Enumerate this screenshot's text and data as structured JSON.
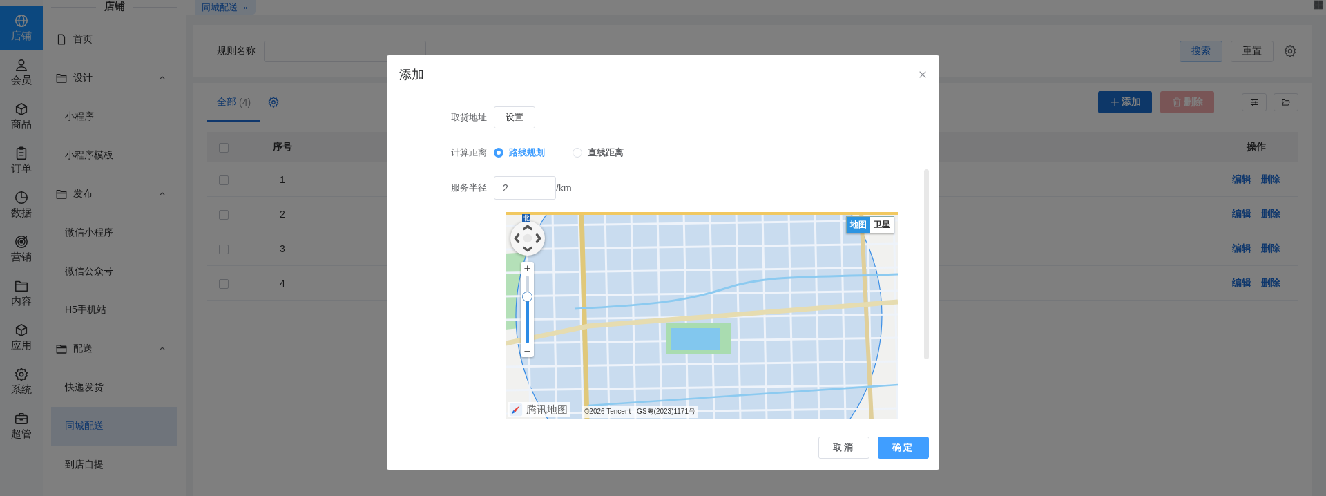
{
  "rail": {
    "items": [
      {
        "label": "店铺",
        "selected": true
      },
      {
        "label": "会员",
        "selected": false
      },
      {
        "label": "商品",
        "selected": false
      },
      {
        "label": "订单",
        "selected": false
      },
      {
        "label": "数据",
        "selected": false
      },
      {
        "label": "营销",
        "selected": false
      },
      {
        "label": "内容",
        "selected": false
      },
      {
        "label": "应用",
        "selected": false
      },
      {
        "label": "系统",
        "selected": false
      },
      {
        "label": "超管",
        "selected": false
      }
    ]
  },
  "sidebar": {
    "title": "店铺",
    "items": [
      {
        "kind": "link",
        "label": "首页",
        "selected": false
      },
      {
        "kind": "group",
        "label": "设计",
        "expanded": true,
        "children": [
          {
            "label": "小程序",
            "selected": false
          },
          {
            "label": "小程序模板",
            "selected": false
          }
        ]
      },
      {
        "kind": "group",
        "label": "发布",
        "expanded": true,
        "children": [
          {
            "label": "微信小程序",
            "selected": false
          },
          {
            "label": "微信公众号",
            "selected": false
          },
          {
            "label": "H5手机站",
            "selected": false
          }
        ]
      },
      {
        "kind": "group",
        "label": "配送",
        "expanded": true,
        "children": [
          {
            "label": "快递发货",
            "selected": false
          },
          {
            "label": "同城配送",
            "selected": true
          },
          {
            "label": "到店自提",
            "selected": false
          }
        ]
      }
    ]
  },
  "page_tabs": [
    {
      "label": "同城配送",
      "selected": true
    }
  ],
  "search": {
    "label": "规则名称",
    "buttons": [
      {
        "label": "搜索",
        "kind": "primary"
      },
      {
        "label": "重置",
        "kind": "default"
      }
    ]
  },
  "table_card": {
    "tabs": [
      {
        "label": "全部",
        "count": "(4)",
        "selected": true
      }
    ],
    "actions": [
      {
        "label": "添加",
        "kind": "add",
        "disabled": false
      },
      {
        "label": "删除",
        "kind": "delete",
        "disabled": true
      }
    ],
    "table": {
      "select_all": {
        "checked": false
      },
      "columns": [
        "序号",
        "操作"
      ],
      "rows": [
        {
          "checked": false,
          "index": "1",
          "actions": [
            "编辑",
            "删除"
          ]
        },
        {
          "checked": false,
          "index": "2",
          "actions": [
            "编辑",
            "删除"
          ]
        },
        {
          "checked": false,
          "index": "3",
          "actions": [
            "编辑",
            "删除"
          ]
        },
        {
          "checked": false,
          "index": "4",
          "actions": [
            "编辑",
            "删除"
          ]
        }
      ]
    }
  },
  "modal": {
    "title": "添加",
    "fields": [
      {
        "kind": "button",
        "label": "取货地址",
        "button": "设置"
      },
      {
        "kind": "radio",
        "label": "计算距离",
        "options": [
          {
            "label": "路线规划",
            "selected": true
          },
          {
            "label": "直线距离",
            "selected": false
          }
        ]
      },
      {
        "kind": "input",
        "label": "服务半径",
        "value": "2",
        "suffix": "/km"
      }
    ],
    "map": {
      "compass": "北",
      "zoom": {
        "level": 0.72
      },
      "map_types": [
        {
          "label": "地图",
          "selected": true
        },
        {
          "label": "卫星",
          "selected": false
        }
      ],
      "logo": "腾讯地图",
      "copyright": "©2026 Tencent - GS粤(2023)1171号"
    },
    "buttons": [
      {
        "label": "取消",
        "kind": "default"
      },
      {
        "label": "确定",
        "kind": "primary"
      }
    ]
  }
}
